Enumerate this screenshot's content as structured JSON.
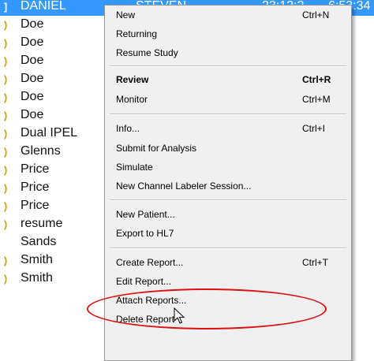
{
  "patient_list": {
    "selected_row": {
      "marker": "]",
      "first_name": "DANIEL",
      "last_name": "STEVEN",
      "time_a": "23:12:2",
      "time_b": "6:53:34"
    },
    "rows": [
      {
        "marker": ")",
        "name": "Doe"
      },
      {
        "marker": ")",
        "name": "Doe"
      },
      {
        "marker": ")",
        "name": "Doe"
      },
      {
        "marker": ")",
        "name": "Doe"
      },
      {
        "marker": ")",
        "name": "Doe"
      },
      {
        "marker": ")",
        "name": "Doe"
      },
      {
        "marker": ")",
        "name": "Dual IPEL"
      },
      {
        "marker": ")",
        "name": "Glenns"
      },
      {
        "marker": ")",
        "name": "Price"
      },
      {
        "marker": ")",
        "name": "Price"
      },
      {
        "marker": ")",
        "name": "Price"
      },
      {
        "marker": ")",
        "name": "resume"
      },
      {
        "marker": "",
        "name": "Sands"
      },
      {
        "marker": ")",
        "name": "Smith"
      },
      {
        "marker": ")",
        "name": "Smith"
      }
    ]
  },
  "context_menu": {
    "items": [
      {
        "label": "New",
        "shortcut": "Ctrl+N"
      },
      {
        "label": "Returning",
        "shortcut": ""
      },
      {
        "label": "Resume Study",
        "shortcut": ""
      },
      {
        "label": "Review",
        "shortcut": "Ctrl+R",
        "bold": true
      },
      {
        "label": "Monitor",
        "shortcut": "Ctrl+M"
      },
      {
        "label": "Info...",
        "shortcut": "Ctrl+I"
      },
      {
        "label": "Submit for Analysis",
        "shortcut": ""
      },
      {
        "label": "Simulate",
        "shortcut": ""
      },
      {
        "label": "New Channel Labeler Session...",
        "shortcut": ""
      },
      {
        "label": "New Patient...",
        "shortcut": ""
      },
      {
        "label": "Export to HL7",
        "shortcut": ""
      },
      {
        "label": "Create Report...",
        "shortcut": "Ctrl+T"
      },
      {
        "label": "Edit Report...",
        "shortcut": ""
      },
      {
        "label": "Attach Reports...",
        "shortcut": ""
      },
      {
        "label": "Delete Report",
        "shortcut": ""
      }
    ]
  },
  "annotation": {
    "highlight_color": "#e01010",
    "highlighted_item": "Attach Reports..."
  },
  "colors": {
    "selection": "#3399ff",
    "menu_background": "#f0f0f0",
    "row_marker": "#c8a200"
  },
  "icons": {
    "row_marker": "status-marker-icon",
    "cursor": "mouse-pointer-icon"
  }
}
